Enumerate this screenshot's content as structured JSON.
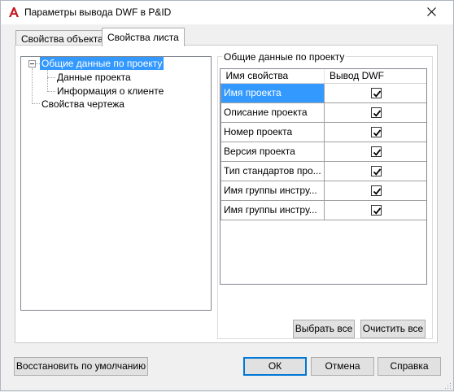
{
  "window": {
    "title": "Параметры вывода DWF в P&ID",
    "icon": "autocad-a-icon",
    "close_icon": "close-icon"
  },
  "tabs": [
    {
      "label": "Свойства объекта",
      "active": false
    },
    {
      "label": "Свойства листа",
      "active": true
    }
  ],
  "tree": {
    "root": {
      "label": "Общие данные по проекту",
      "selected": true,
      "expanded": true
    },
    "children": [
      {
        "label": "Данные проекта"
      },
      {
        "label": "Информация о клиенте"
      }
    ],
    "sibling": {
      "label": "Свойства чертежа"
    }
  },
  "group": {
    "label": "Общие данные по проекту",
    "columns": [
      "Имя свойства",
      "Вывод DWF"
    ],
    "rows": [
      {
        "name": "Имя проекта",
        "checked": true,
        "selected": true
      },
      {
        "name": "Описание проекта",
        "checked": true,
        "selected": false
      },
      {
        "name": "Номер проекта",
        "checked": true,
        "selected": false
      },
      {
        "name": "Версия проекта",
        "checked": true,
        "selected": false
      },
      {
        "name": "Тип стандартов про...",
        "checked": true,
        "selected": false
      },
      {
        "name": "Имя группы инстру...",
        "checked": true,
        "selected": false
      },
      {
        "name": "Имя группы инстру...",
        "checked": true,
        "selected": false
      }
    ],
    "select_all_label": "Выбрать все",
    "clear_all_label": "Очистить все"
  },
  "footer": {
    "restore_label": "Восстановить по умолчанию",
    "ok_label": "ОК",
    "cancel_label": "Отмена",
    "help_label": "Справка"
  },
  "colors": {
    "selection": "#3399ff",
    "app_icon_red": "#c4161c",
    "default_button_border": "#0078d7"
  }
}
